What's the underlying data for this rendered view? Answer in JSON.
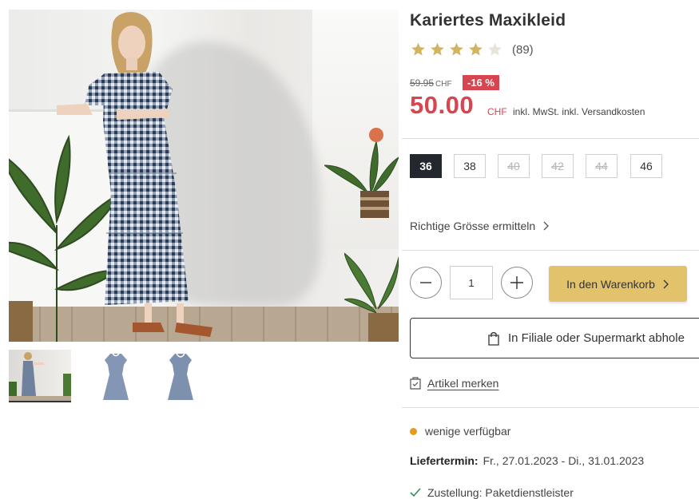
{
  "product": {
    "title": "Kariertes Maxikleid",
    "rating": 4,
    "rating_max": 5,
    "rating_count": "(89)"
  },
  "pricing": {
    "old_price": "59.95",
    "old_currency": "CHF",
    "discount": "-16 %",
    "price": "50.00",
    "currency": "CHF",
    "price_note": "inkl. MwSt. inkl. Versandkosten"
  },
  "sizes": [
    {
      "label": "36",
      "state": "selected"
    },
    {
      "label": "38",
      "state": "available"
    },
    {
      "label": "40",
      "state": "unavailable"
    },
    {
      "label": "42",
      "state": "unavailable"
    },
    {
      "label": "44",
      "state": "unavailable"
    },
    {
      "label": "46",
      "state": "available"
    }
  ],
  "size_finder": {
    "label": "Richtige Grösse ermitteln"
  },
  "cart": {
    "quantity": "1",
    "add_label": "In den Warenkorb",
    "store_label": "In Filiale oder Supermarkt abhole"
  },
  "wishlist": {
    "label": "Artikel merken"
  },
  "availability": {
    "label": "wenige verfügbar",
    "color": "#e39c1c"
  },
  "delivery": {
    "label": "Liefertermin:",
    "value": "Fr., 27.01.2023 - Di., 31.01.2023"
  },
  "shipping": {
    "label": "Zustellung: Paketdienstleister"
  },
  "colors": {
    "accent": "#d64550",
    "cart_button": "#e2c26b",
    "selected_size": "#23282e"
  },
  "gallery": {
    "thumb_count": 3,
    "active_index": 0
  }
}
